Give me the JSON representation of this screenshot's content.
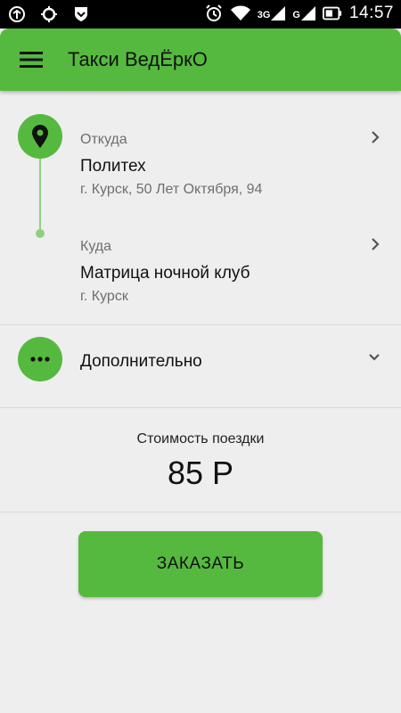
{
  "status_bar": {
    "network": "3G",
    "network2": "G",
    "time": "14:57",
    "icons": [
      "usb-debug-icon",
      "sync-icon",
      "shield-icon",
      "alarm-icon",
      "wifi-icon",
      "signal-icon",
      "battery-icon"
    ]
  },
  "app_bar": {
    "title": "Такси ВедЁркО",
    "menu_icon": "hamburger-menu-icon"
  },
  "route": {
    "from": {
      "label": "Откуда",
      "place": "Политех",
      "address": "г. Курск, 50 Лет Октября, 94"
    },
    "to": {
      "label": "Куда",
      "place": "Матрица ночной клуб",
      "address": "г. Курск"
    }
  },
  "extra": {
    "label": "Дополнительно"
  },
  "price": {
    "label": "Стоимость поездки",
    "value": "85 Р"
  },
  "order_button": {
    "label": "ЗАКАЗАТЬ"
  },
  "colors": {
    "accent": "#56b93f",
    "route_line": "#8fd07f",
    "background": "#eeeeee"
  }
}
